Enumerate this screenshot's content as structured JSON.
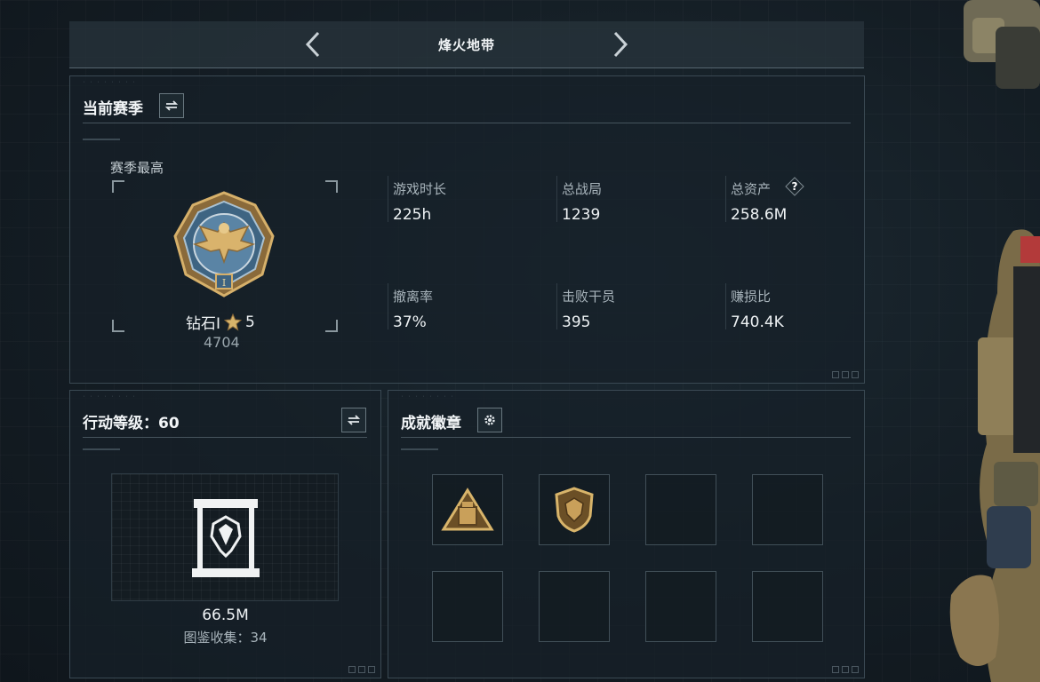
{
  "header": {
    "title": "烽火地带"
  },
  "season_panel": {
    "title": "当前赛季",
    "best_label": "赛季最高",
    "rank_name": "钻石I",
    "rank_stars": "5",
    "rank_points": "4704",
    "stats": [
      {
        "label": "游戏时长",
        "value": "225h"
      },
      {
        "label": "总战局",
        "value": "1239"
      },
      {
        "label": "总资产",
        "value": "258.6M",
        "help": "?"
      },
      {
        "label": "撤离率",
        "value": "37%"
      },
      {
        "label": "击败干员",
        "value": "395"
      },
      {
        "label": "赚损比",
        "value": "740.4K"
      }
    ]
  },
  "level_panel": {
    "title": "行动等级：60",
    "value": "66.5M",
    "collection_label": "图鉴收集：34"
  },
  "badge_panel": {
    "title": "成就徽章"
  },
  "colors": {
    "accent_gold": "#c9a05a",
    "panel_border": "#3a4953",
    "text_primary": "#eef2f4",
    "text_secondary": "#a8b4bb"
  },
  "icons": {
    "prev": "chevron-left-icon",
    "next": "chevron-right-icon",
    "switch": "swap-icon",
    "settings": "gear-icon",
    "help": "question-icon"
  }
}
